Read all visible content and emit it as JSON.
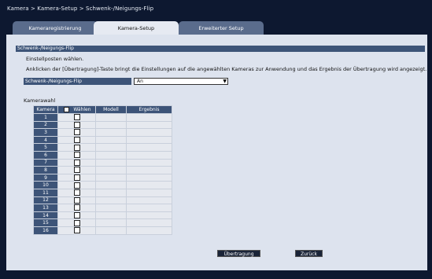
{
  "breadcrumb": "Kamera > Kamera-Setup > Schwenk-/Neigungs-Flip",
  "tabs": [
    {
      "label": "Kameraregistrierung",
      "active": false
    },
    {
      "label": "Kamera-Setup",
      "active": true
    },
    {
      "label": "Erweiterter Setup",
      "active": false
    }
  ],
  "section": {
    "title": "Schwenk-/Neigungs-Flip",
    "instruction1": "Einstellposten wählen.",
    "instruction2": "Anklicken der [Übertragung]-Taste bringt die Einstellungen auf die angewählten Kameras zur Anwendung und das Ergebnis der Übertragung wird angezeigt."
  },
  "setting": {
    "label": "Schwenk-/Neigungs-Flip",
    "value": "An",
    "arrow_icon": "dropdown-arrow-icon"
  },
  "camera_select": {
    "title": "Kamerawahl",
    "headers": {
      "camera": "Kamera",
      "select": "Wählen",
      "model": "Modell",
      "result": "Ergebnis"
    },
    "rows": [
      {
        "num": "1",
        "checked": false,
        "model": "",
        "result": ""
      },
      {
        "num": "2",
        "checked": false,
        "model": "",
        "result": ""
      },
      {
        "num": "3",
        "checked": false,
        "model": "",
        "result": ""
      },
      {
        "num": "4",
        "checked": false,
        "model": "",
        "result": ""
      },
      {
        "num": "5",
        "checked": false,
        "model": "",
        "result": ""
      },
      {
        "num": "6",
        "checked": false,
        "model": "",
        "result": ""
      },
      {
        "num": "7",
        "checked": false,
        "model": "",
        "result": ""
      },
      {
        "num": "8",
        "checked": false,
        "model": "",
        "result": ""
      },
      {
        "num": "9",
        "checked": false,
        "model": "",
        "result": ""
      },
      {
        "num": "10",
        "checked": false,
        "model": "",
        "result": ""
      },
      {
        "num": "11",
        "checked": false,
        "model": "",
        "result": ""
      },
      {
        "num": "12",
        "checked": false,
        "model": "",
        "result": ""
      },
      {
        "num": "13",
        "checked": false,
        "model": "",
        "result": ""
      },
      {
        "num": "14",
        "checked": false,
        "model": "",
        "result": ""
      },
      {
        "num": "15",
        "checked": false,
        "model": "",
        "result": ""
      },
      {
        "num": "16",
        "checked": false,
        "model": "",
        "result": ""
      }
    ]
  },
  "buttons": {
    "transfer": "Übertragung",
    "back": "Zurück"
  },
  "colors": {
    "background": "#0d1830",
    "panel": "#dde3ee",
    "header_blue": "#3d5478",
    "tab_inactive": "#5a6c8c",
    "button": "#1a2438"
  }
}
